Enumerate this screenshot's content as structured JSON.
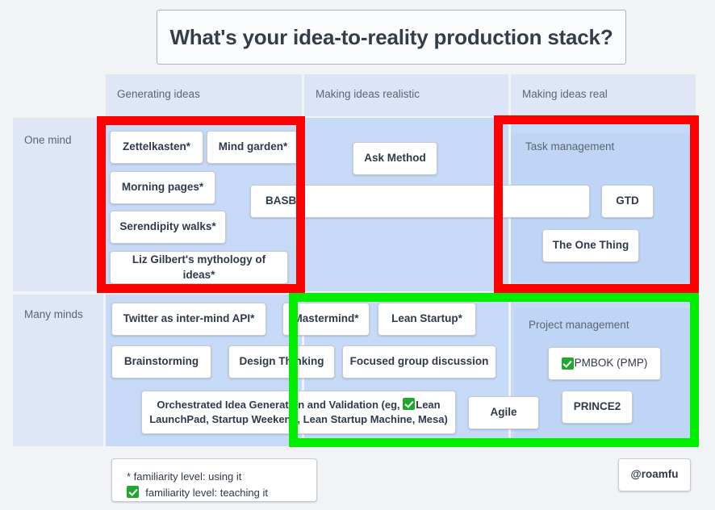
{
  "header": {
    "title": "What's your idea-to-reality production stack?"
  },
  "columns": [
    {
      "label": "Generating ideas"
    },
    {
      "label": "Making ideas realistic"
    },
    {
      "label": "Making ideas real"
    }
  ],
  "rows": [
    {
      "label": "One mind"
    },
    {
      "label": "Many minds"
    }
  ],
  "cards": {
    "zettelkasten": "Zettelkasten*",
    "mind_garden": "Mind garden*",
    "morning_pages": "Morning pages*",
    "serendipity_walks": "Serendipity walks*",
    "liz_gilbert": "Liz Gilbert's mythology of ideas*",
    "basb": "BASB",
    "ask_method": "Ask Method",
    "gtd": "GTD",
    "the_one_thing": "The One Thing",
    "twitter_api": "Twitter as inter-mind API*",
    "brainstorming": "Brainstorming",
    "design_thinking": "Design Thinking",
    "mastermind": "Mastermind*",
    "lean_startup": "Lean Startup*",
    "focused_group": "Focused group discussion",
    "orchestrated_line1": "Orchestrated Idea Generation and Validation (eg, ",
    "orchestrated_lean": "Lean",
    "orchestrated_line2": "LaunchPad, Startup Weekend, Lean Startup Machine, Mesa)",
    "agile": "Agile",
    "pmbok": "PMBOK (PMP)",
    "prince2": "PRINCE2"
  },
  "groups": {
    "task_management": "Task management",
    "project_management": "Project management"
  },
  "legend": {
    "line1": "* familiarity level: using it",
    "line2": "familiarity level: teaching it"
  },
  "footer": {
    "handle": "@roamfu"
  },
  "annotations": {
    "red_color": "#ff0000",
    "green_color": "#00ee00",
    "checkmark_color": "#1fa82c"
  },
  "colors": {
    "page_background": "#f1f3f5",
    "panel_light": "#dfe6f6",
    "cell_blue": "#c6daf7",
    "group_blue": "#bed5f5",
    "card_white": "#ffffff",
    "text_dark": "#2f3a4c",
    "text_muted": "#5d6472"
  }
}
